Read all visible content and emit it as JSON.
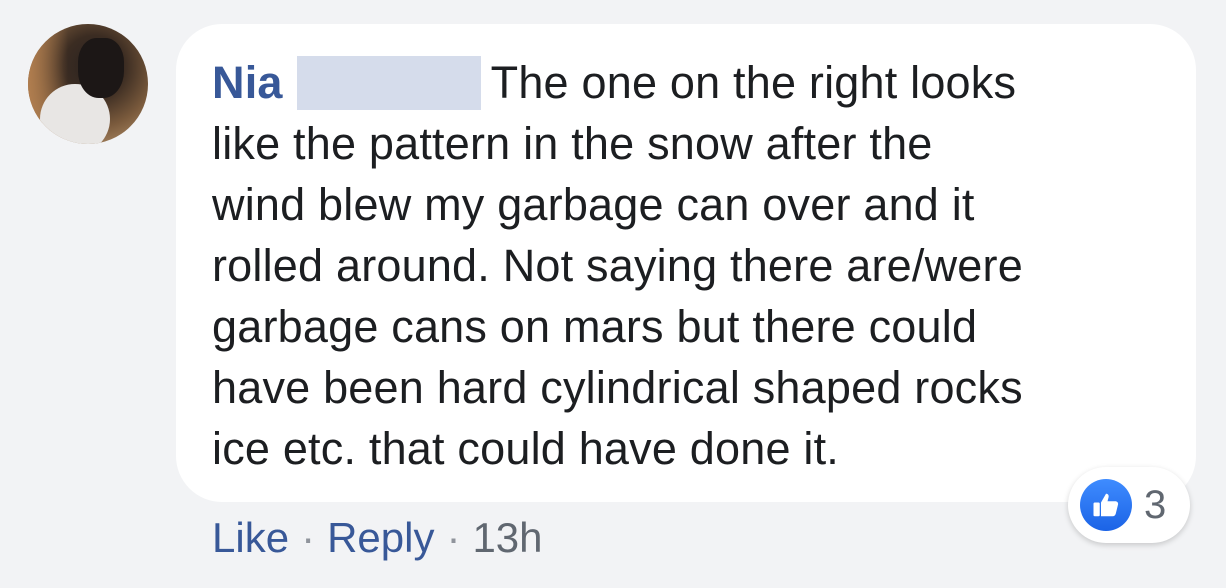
{
  "comment": {
    "author": "Nia",
    "body_lines": [
      "The one on the right looks",
      "like the pattern in the snow after the",
      "wind blew my garbage can over and it",
      "rolled around. Not saying there are/were",
      "garbage cans on mars but there could",
      "have been hard cylindrical shaped rocks",
      "ice etc. that could have done it."
    ]
  },
  "reaction": {
    "icon": "thumbs-up-icon",
    "count": "3",
    "color": "#1b63e6"
  },
  "actions": {
    "like_label": "Like",
    "separator": "·",
    "reply_label": "Reply",
    "timestamp": "13h"
  },
  "colors": {
    "author": "#385898",
    "text": "#1c1e21",
    "muted": "#606770",
    "bubble": "#ffffff",
    "background": "#f2f3f5"
  }
}
